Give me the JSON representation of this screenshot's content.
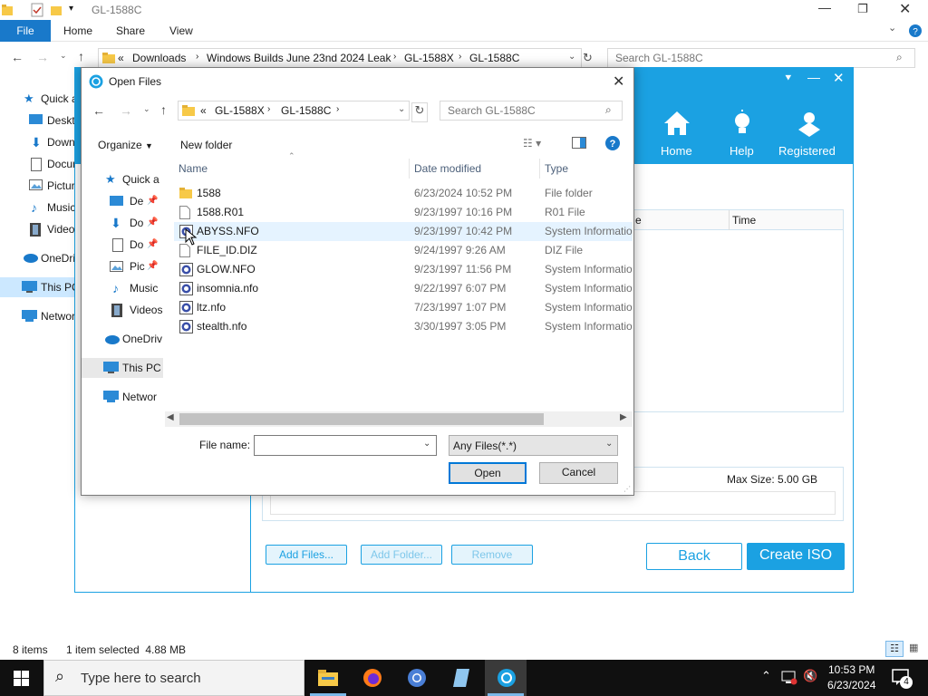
{
  "explorer": {
    "title": "GL-1588C",
    "ribbon_tabs": [
      "File",
      "Home",
      "Share",
      "View"
    ],
    "address": [
      "«",
      "Downloads",
      "Windows Builds June 23nd 2024 Leak",
      "GL-1588X",
      "GL-1588C"
    ],
    "search_placeholder": "Search GL-1588C",
    "nav": [
      "Quick access",
      "Desktop",
      "Downloads",
      "Documents",
      "Pictures",
      "Music",
      "Videos",
      "OneDrive",
      "This PC",
      "Network"
    ],
    "status_items": "8 items",
    "status_selected": "1 item selected  4.88 MB"
  },
  "app": {
    "nav": [
      "Home",
      "Help",
      "Registered"
    ],
    "col_time": "Time",
    "col_e": "e",
    "max_size": "Max Size: 5.00 GB",
    "buttons": {
      "add_files": "Add Files...",
      "add_folder": "Add Folder...",
      "remove": "Remove",
      "back": "Back",
      "create": "Create ISO"
    }
  },
  "dialog": {
    "title": "Open Files",
    "path": [
      "«",
      "GL-1588X",
      "GL-1588C"
    ],
    "search_placeholder": "Search GL-1588C",
    "organize": "Organize",
    "new_folder": "New folder",
    "nav": [
      "Quick a",
      "De",
      "Do",
      "Do",
      "Pic",
      "Music",
      "Videos",
      "OneDriv",
      "This PC",
      "Networ"
    ],
    "columns": {
      "name": "Name",
      "date": "Date modified",
      "type": "Type"
    },
    "files": [
      {
        "name": "1588",
        "date": "6/23/2024 10:52 PM",
        "type": "File folder",
        "icon": "folder-icon"
      },
      {
        "name": "1588.R01",
        "date": "9/23/1997 10:16 PM",
        "type": "R01 File",
        "icon": "file-icon"
      },
      {
        "name": "ABYSS.NFO",
        "date": "9/23/1997 10:42 PM",
        "type": "System Informatio",
        "icon": "nfo-icon"
      },
      {
        "name": "FILE_ID.DIZ",
        "date": "9/24/1997 9:26 AM",
        "type": "DIZ File",
        "icon": "file-icon"
      },
      {
        "name": "GLOW.NFO",
        "date": "9/23/1997 11:56 PM",
        "type": "System Informatio",
        "icon": "nfo-icon"
      },
      {
        "name": "insomnia.nfo",
        "date": "9/22/1997 6:07 PM",
        "type": "System Informatio",
        "icon": "nfo-icon"
      },
      {
        "name": "ltz.nfo",
        "date": "7/23/1997 1:07 PM",
        "type": "System Informatio",
        "icon": "nfo-icon"
      },
      {
        "name": "stealth.nfo",
        "date": "3/30/1997 3:05 PM",
        "type": "System Informatio",
        "icon": "nfo-icon"
      }
    ],
    "filename_label": "File name:",
    "filename_value": "",
    "filter": "Any Files(*.*)",
    "open": "Open",
    "cancel": "Cancel"
  },
  "taskbar": {
    "search_placeholder": "Type here to search",
    "time": "10:53 PM",
    "date": "6/23/2024",
    "notification_count": "4"
  },
  "colors": {
    "accent": "#1ba1e2",
    "file_tab": "#1979ca",
    "taskbar": "#101010",
    "selected_row": "#e5f3ff"
  }
}
